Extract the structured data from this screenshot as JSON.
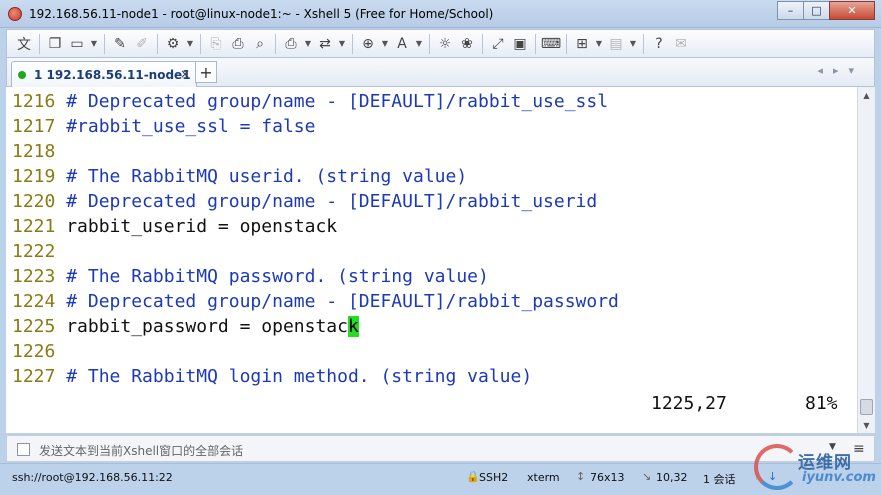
{
  "window": {
    "title": "192.168.56.11-node1 - root@linux-node1:~ - Xshell 5 (Free for Home/School)",
    "buttons": {
      "minimize": "–",
      "maximize": "□",
      "close": "✕"
    }
  },
  "toolbar": {
    "items": [
      {
        "name": "language-icon",
        "glyph": "文"
      },
      {
        "name": "new-session-icon",
        "glyph": "❐"
      },
      {
        "name": "open-folder-icon",
        "glyph": "▭"
      },
      {
        "name": "brush-icon",
        "glyph": "✎"
      },
      {
        "name": "pen-icon",
        "glyph": "✐"
      },
      {
        "name": "properties-icon",
        "glyph": "⚙"
      },
      {
        "name": "copy-icon",
        "glyph": "⎘"
      },
      {
        "name": "paste-icon",
        "glyph": "⎙"
      },
      {
        "name": "find-icon",
        "glyph": "⌕"
      },
      {
        "name": "print-icon",
        "glyph": "⎙"
      },
      {
        "name": "transfer-icon",
        "glyph": "⇄"
      },
      {
        "name": "globe-icon",
        "glyph": "⊕"
      },
      {
        "name": "font-icon",
        "glyph": "A"
      },
      {
        "name": "xftp-icon",
        "glyph": "☼"
      },
      {
        "name": "xmanager-icon",
        "glyph": "❀"
      },
      {
        "name": "fullscreen-icon",
        "glyph": "⤢"
      },
      {
        "name": "lock-icon",
        "glyph": "▣"
      },
      {
        "name": "keyboard-icon",
        "glyph": "⌨"
      },
      {
        "name": "add-window-icon",
        "glyph": "⊞"
      },
      {
        "name": "layout-icon",
        "glyph": "▤"
      },
      {
        "name": "help-icon",
        "glyph": "?"
      },
      {
        "name": "chat-icon",
        "glyph": "✉"
      }
    ]
  },
  "tabs": [
    {
      "label": "1 192.168.56.11-node1",
      "status_color": "#1ea81e",
      "close": "×"
    }
  ],
  "tab_add": "+",
  "terminal": {
    "lines": [
      {
        "num": "1216",
        "text": "# Deprecated group/name - [DEFAULT]/rabbit_use_ssl",
        "kind": "comment"
      },
      {
        "num": "1217",
        "text": "#rabbit_use_ssl = false",
        "kind": "comment"
      },
      {
        "num": "1218",
        "text": "",
        "kind": "code"
      },
      {
        "num": "1219",
        "text": "# The RabbitMQ userid. (string value)",
        "kind": "comment"
      },
      {
        "num": "1220",
        "text": "# Deprecated group/name - [DEFAULT]/rabbit_userid",
        "kind": "comment"
      },
      {
        "num": "1221",
        "text": "rabbit_userid = openstack",
        "kind": "code"
      },
      {
        "num": "1222",
        "text": "",
        "kind": "code"
      },
      {
        "num": "1223",
        "text": "# The RabbitMQ password. (string value)",
        "kind": "comment"
      },
      {
        "num": "1224",
        "text": "# Deprecated group/name - [DEFAULT]/rabbit_password",
        "kind": "comment"
      },
      {
        "num": "1225",
        "text": "rabbit_password = openstac",
        "cursor_char": "k",
        "kind": "code"
      },
      {
        "num": "1226",
        "text": "",
        "kind": "code"
      },
      {
        "num": "1227",
        "text": "# The RabbitMQ login method. (string value)",
        "kind": "comment"
      }
    ],
    "cursor_position": "1225,27",
    "scroll_percent": "81%"
  },
  "send_bar": {
    "placeholder": "发送文本到当前Xshell窗口的全部会话"
  },
  "status_bar": {
    "connection": "ssh://root@192.168.56.11:22",
    "protocol": "SSH2",
    "terminal_type": "xterm",
    "size": "76x13",
    "cursor": "10,32",
    "sessions": "1 会话"
  },
  "watermark": {
    "cn": "运维网",
    "en": "iyunv.com"
  }
}
